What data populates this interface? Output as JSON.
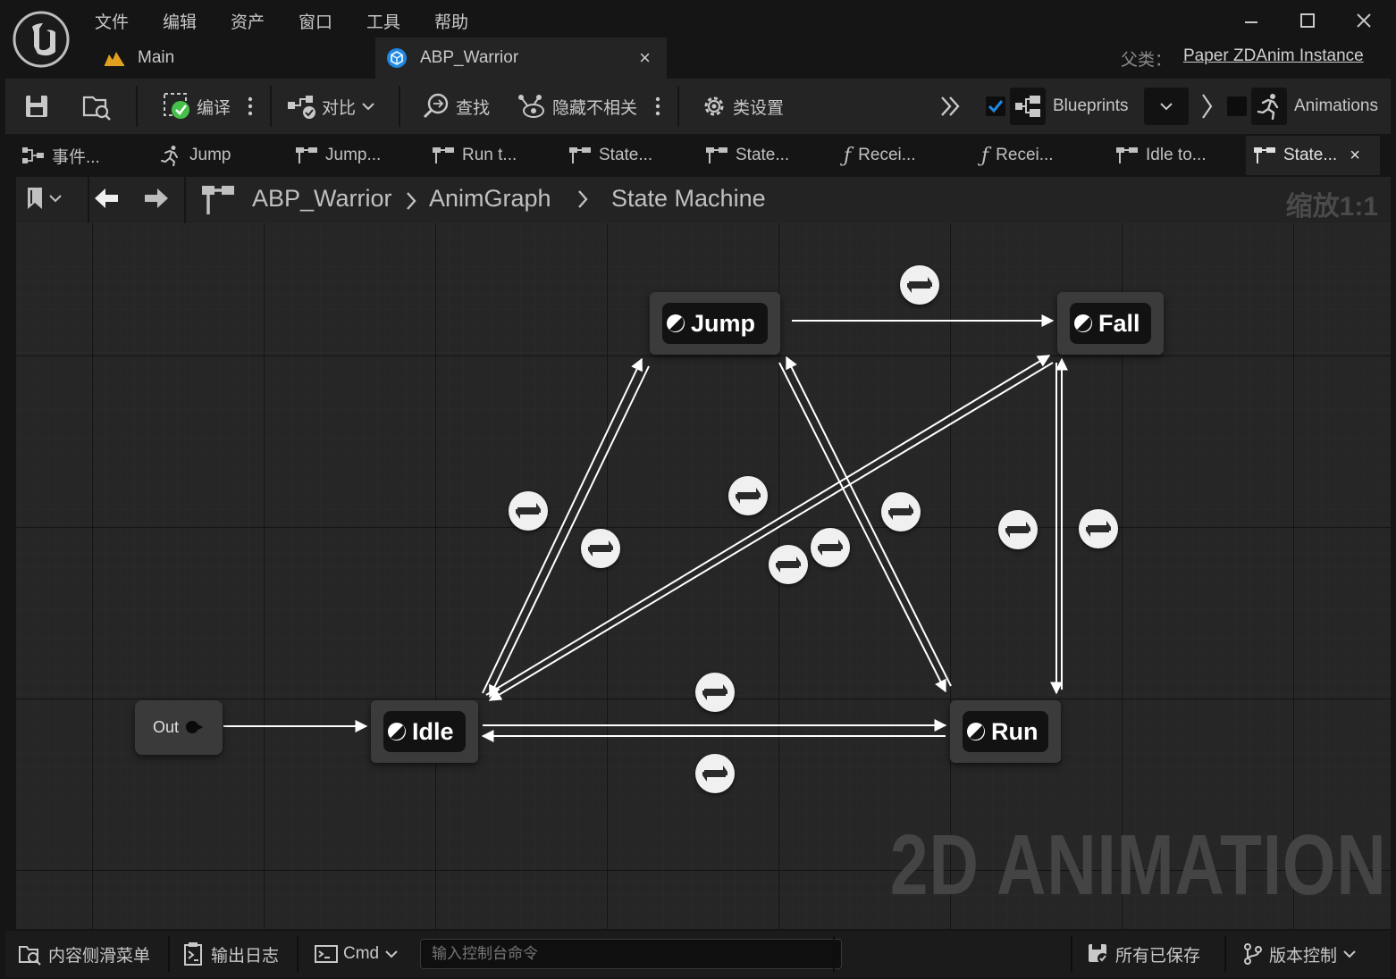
{
  "menu": [
    "文件",
    "编辑",
    "资产",
    "窗口",
    "工具",
    "帮助"
  ],
  "tabs": [
    {
      "label": "Main"
    },
    {
      "label": "ABP_Warrior",
      "close": "×"
    }
  ],
  "parent_class": {
    "label": "父类：",
    "value": "Paper ZDAnim Instance"
  },
  "toolbar": {
    "compile": "编译",
    "diff": "对比",
    "find": "查找",
    "hide_unrelated": "隐藏不相关",
    "class_settings": "类设置",
    "blueprints": "Blueprints",
    "animations": "Animations"
  },
  "graph_tabs": [
    "事件...",
    "Jump",
    "Jump...",
    "Run t...",
    "State...",
    "State...",
    "Recei...",
    "Recei...",
    "Idle to...",
    "State..."
  ],
  "graph_tab_close": "×",
  "breadcrumb": {
    "root": "ABP_Warrior",
    "graph": "AnimGraph",
    "current": "State Machine"
  },
  "zoom": "缩放1:1",
  "watermark": "2D ANIMATION",
  "nodes": {
    "out": "Out",
    "idle": "Idle",
    "jump": "Jump",
    "fall": "Fall",
    "run": "Run"
  },
  "statusbar": {
    "content_drawer": "内容侧滑菜单",
    "output_log": "输出日志",
    "cmd": "Cmd",
    "console_placeholder": "输入控制台命令",
    "all_saved": "所有已保存",
    "source_control": "版本控制"
  },
  "colors": {
    "accent_blue": "#1e88e5",
    "check_green": "#45c04a",
    "bg": "#151515",
    "canvas": "#262626"
  }
}
